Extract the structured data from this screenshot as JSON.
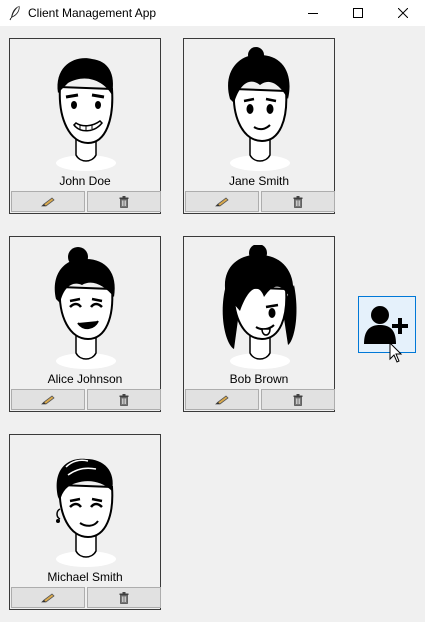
{
  "window": {
    "title": "Client Management App",
    "controls": [
      "minimize-icon",
      "maximize-icon",
      "close-icon"
    ]
  },
  "clients": [
    {
      "name": "John Doe",
      "avatar": "avatar-short-hair-grin"
    },
    {
      "name": "Jane Smith",
      "avatar": "avatar-messy-bun"
    },
    {
      "name": "Alice Johnson",
      "avatar": "avatar-bun-smile"
    },
    {
      "name": "Bob Brown",
      "avatar": "avatar-long-bangs-tongue"
    },
    {
      "name": "Michael Smith",
      "avatar": "avatar-braids-earring"
    }
  ],
  "card_actions": {
    "edit_icon": "pencil-icon",
    "delete_icon": "trash-icon"
  },
  "add_button": {
    "icon": "add-user-icon"
  },
  "colors": {
    "background": "#f0f0f0",
    "titlebar": "#ffffff",
    "button": "#e1e1e1",
    "add_button_bg": "#e5f1fb",
    "add_button_border": "#0078d7"
  }
}
